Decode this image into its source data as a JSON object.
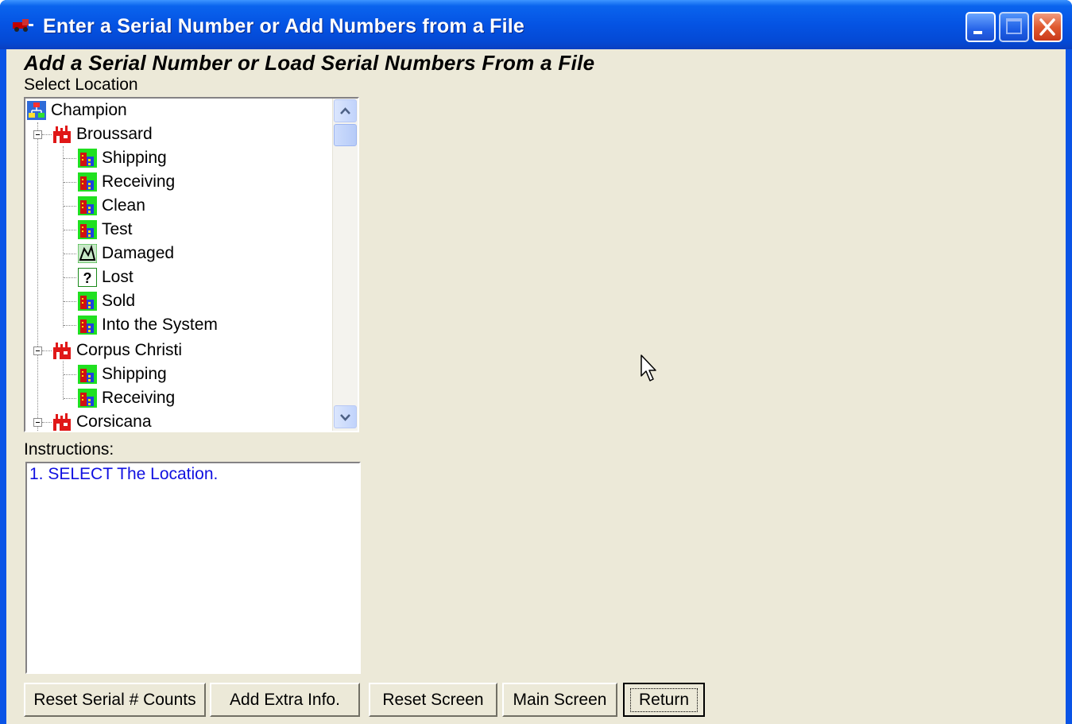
{
  "window": {
    "title": "Enter a Serial Number or Add Numbers from a File"
  },
  "heading": "Add a Serial Number or Load Serial Numbers From a File",
  "select_location_label": "Select Location",
  "tree": {
    "root": "Champion",
    "groups": [
      {
        "label": "Broussard",
        "children": [
          "Shipping",
          "Receiving",
          "Clean",
          "Test",
          "Damaged",
          "Lost",
          "Sold",
          "Into the System"
        ]
      },
      {
        "label": "Corpus Christi",
        "children": [
          "Shipping",
          "Receiving"
        ]
      },
      {
        "label": "Corsicana",
        "children": []
      }
    ]
  },
  "instructions_label": "Instructions:",
  "instructions_text": "1.  SELECT The Location.",
  "buttons": {
    "reset_counts": "Reset Serial # Counts",
    "add_extra": "Add Extra Info.",
    "reset_screen": "Reset Screen",
    "main_screen": "Main Screen",
    "return": "Return"
  },
  "colors": {
    "titlebar": "#0553e3",
    "client": "#ece9d8",
    "instructions_text": "#1010e0"
  }
}
